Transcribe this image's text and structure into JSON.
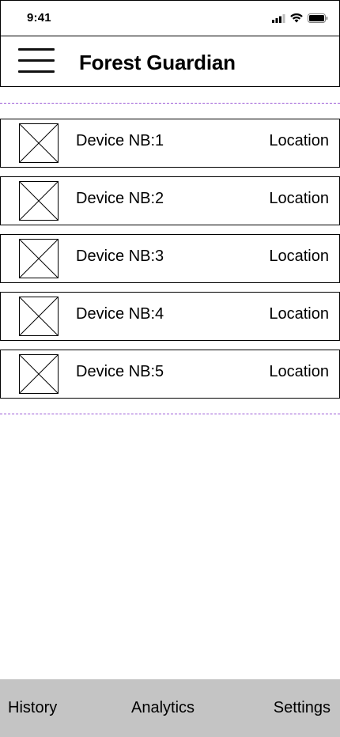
{
  "status_bar": {
    "time": "9:41",
    "icons": [
      "cellular-signal-icon",
      "wifi-icon",
      "battery-icon"
    ]
  },
  "header": {
    "title": "Forest Guardian",
    "menu_icon": "hamburger-menu-icon"
  },
  "devices": [
    {
      "name": "Device NB:1",
      "location": "Location",
      "thumbnail": "image-placeholder-icon"
    },
    {
      "name": "Device NB:2",
      "location": "Location",
      "thumbnail": "image-placeholder-icon"
    },
    {
      "name": "Device NB:3",
      "location": "Location",
      "thumbnail": "image-placeholder-icon"
    },
    {
      "name": "Device NB:4",
      "location": "Location",
      "thumbnail": "image-placeholder-icon"
    },
    {
      "name": "Device NB:5",
      "location": "Location",
      "thumbnail": "image-placeholder-icon"
    }
  ],
  "bottom_nav": {
    "history": "History",
    "analytics": "Analytics",
    "settings": "Settings"
  },
  "colors": {
    "divider_dashed": "#9b59d6",
    "bottom_nav_bg": "#c4c4c4",
    "border": "#000000"
  }
}
